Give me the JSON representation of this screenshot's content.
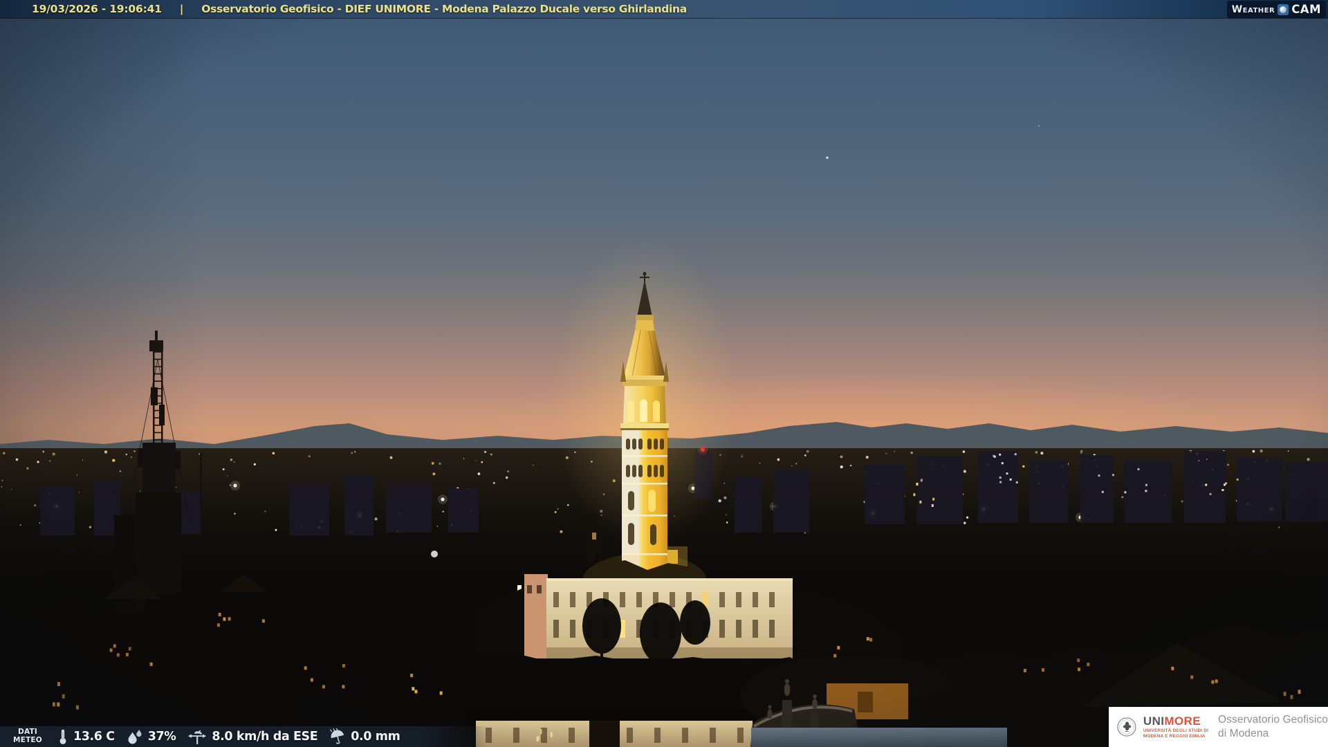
{
  "header": {
    "timestamp": "19/03/2026 - 19:06:41",
    "separator": "|",
    "title": "Osservatorio Geofisico - DIEF UNIMORE - Modena Palazzo Ducale verso Ghirlandina",
    "weathercam": {
      "word1": "Weather",
      "word2": "CAM"
    }
  },
  "meteo_bar": {
    "label": {
      "line1": "DATI",
      "line2": "METEO"
    },
    "readings": [
      {
        "icon": "thermometer-icon",
        "value": "13.6 C"
      },
      {
        "icon": "humidity-icon",
        "value": "37%"
      },
      {
        "icon": "wind-vane-icon",
        "value": "8.0 km/h da ESE"
      },
      {
        "icon": "rain-umbrella-icon",
        "value": "0.0 mm"
      }
    ]
  },
  "logo_box": {
    "wordmark": {
      "uni": "UNI",
      "more": "MORE"
    },
    "subtext": {
      "line1": "UNIVERSITÀ DEGLI STUDI DI",
      "line2": "MODENA E REGGIO EMILIA"
    },
    "org": {
      "line1": "Osservatorio Geofisico",
      "line2": "di Modena"
    }
  },
  "colors": {
    "header_text": "#eae189",
    "header_bar": "#2f5074",
    "meteo_bar_bg": "#18212d",
    "weathercam_blue": "#2e6ba6",
    "unimore_gray": "#55575c",
    "unimore_orange": "#e0513b",
    "org_text": "#8e9095",
    "sky_top": "#3d5774",
    "sunset_orange": "#d29877",
    "tower_gold": "#f2c23a"
  }
}
